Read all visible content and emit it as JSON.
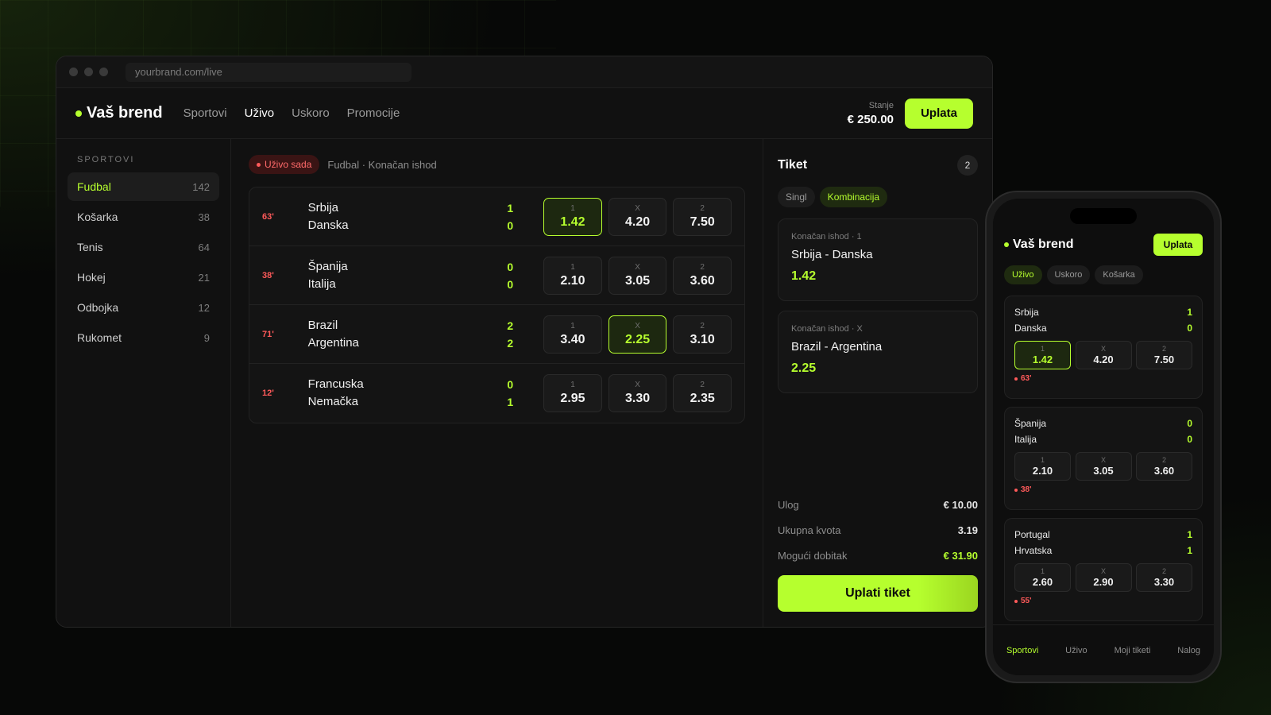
{
  "browser": {
    "url": "yourbrand.com/live"
  },
  "header": {
    "brand": "Vaš brend",
    "nav": [
      "Sportovi",
      "Uživo",
      "Uskoro",
      "Promocije"
    ],
    "active_nav": "Uživo",
    "balance_label": "Stanje",
    "balance_value": "€ 250.00",
    "deposit_label": "Uplata"
  },
  "sidebar": {
    "title": "SPORTOVI",
    "items": [
      {
        "label": "Fudbal",
        "count": "142"
      },
      {
        "label": "Košarka",
        "count": "38"
      },
      {
        "label": "Tenis",
        "count": "64"
      },
      {
        "label": "Hokej",
        "count": "21"
      },
      {
        "label": "Odbojka",
        "count": "12"
      },
      {
        "label": "Rukomet",
        "count": "9"
      }
    ]
  },
  "main": {
    "live_badge": "Uživo sada",
    "breadcrumb": "Fudbal · Konačan ishod",
    "matches": [
      {
        "minute": "63'",
        "home": "Srbija",
        "away": "Danska",
        "home_score": "1",
        "away_score": "0",
        "odds": [
          {
            "label": "1",
            "value": "1.42"
          },
          {
            "label": "X",
            "value": "4.20"
          },
          {
            "label": "2",
            "value": "7.50"
          }
        ]
      },
      {
        "minute": "38'",
        "home": "Španija",
        "away": "Italija",
        "home_score": "0",
        "away_score": "0",
        "odds": [
          {
            "label": "1",
            "value": "2.10"
          },
          {
            "label": "X",
            "value": "3.05"
          },
          {
            "label": "2",
            "value": "3.60"
          }
        ]
      },
      {
        "minute": "71'",
        "home": "Brazil",
        "away": "Argentina",
        "home_score": "2",
        "away_score": "2",
        "odds": [
          {
            "label": "1",
            "value": "3.40"
          },
          {
            "label": "X",
            "value": "2.25"
          },
          {
            "label": "2",
            "value": "3.10"
          }
        ]
      },
      {
        "minute": "12'",
        "home": "Francuska",
        "away": "Nemačka",
        "home_score": "0",
        "away_score": "1",
        "odds": [
          {
            "label": "1",
            "value": "2.95"
          },
          {
            "label": "X",
            "value": "3.30"
          },
          {
            "label": "2",
            "value": "2.35"
          }
        ]
      }
    ]
  },
  "ticket": {
    "title": "Tiket",
    "count": "2",
    "tabs": [
      "Singl",
      "Kombinacija"
    ],
    "selections": [
      {
        "market": "Konačan ishod · 1",
        "match": "Srbija - Danska",
        "odd": "1.42"
      },
      {
        "market": "Konačan ishod · X",
        "match": "Brazil - Argentina",
        "odd": "2.25"
      }
    ],
    "stake_label": "Ulog",
    "stake_value": "€ 10.00",
    "total_odds_label": "Ukupna kvota",
    "total_odds_value": "3.19",
    "payout_label": "Mogući dobitak",
    "payout_value": "€ 31.90",
    "submit_label": "Uplati tiket"
  },
  "phone": {
    "brand": "Vaš brend",
    "deposit_label": "Uplata",
    "tabs": [
      "Uživo",
      "Uskoro",
      "Košarka"
    ],
    "matches": [
      {
        "home": "Srbija",
        "away": "Danska",
        "home_score": "1",
        "away_score": "0",
        "minute": "63'",
        "odds": [
          {
            "label": "1",
            "value": "1.42"
          },
          {
            "label": "X",
            "value": "4.20"
          },
          {
            "label": "2",
            "value": "7.50"
          }
        ]
      },
      {
        "home": "Španija",
        "away": "Italija",
        "home_score": "0",
        "away_score": "0",
        "minute": "38'",
        "odds": [
          {
            "label": "1",
            "value": "2.10"
          },
          {
            "label": "X",
            "value": "3.05"
          },
          {
            "label": "2",
            "value": "3.60"
          }
        ]
      },
      {
        "home": "Portugal",
        "away": "Hrvatska",
        "home_score": "1",
        "away_score": "1",
        "minute": "55'",
        "odds": [
          {
            "label": "1",
            "value": "2.60"
          },
          {
            "label": "X",
            "value": "2.90"
          },
          {
            "label": "2",
            "value": "3.30"
          }
        ]
      }
    ],
    "bottom_nav": [
      "Sportovi",
      "Uživo",
      "Moji tiketi",
      "Nalog"
    ]
  }
}
